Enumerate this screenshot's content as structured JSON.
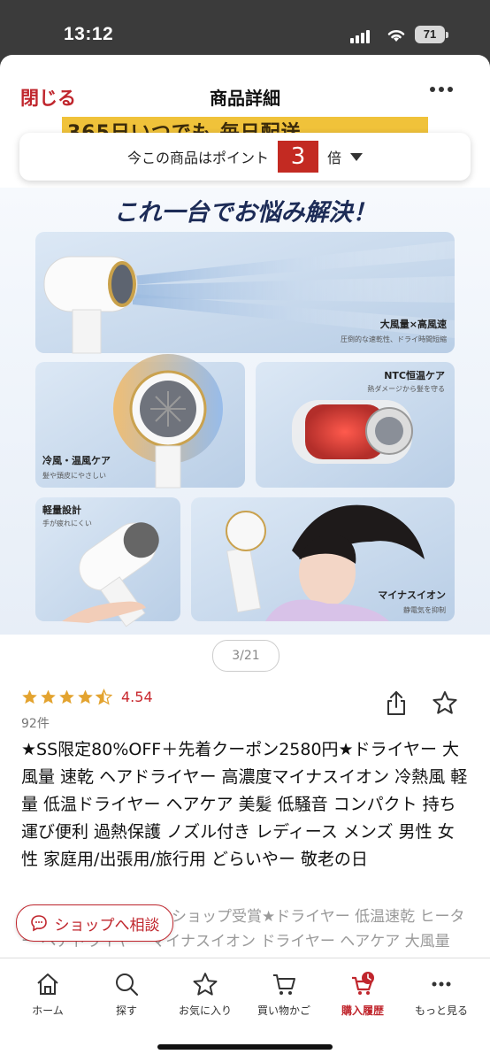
{
  "status": {
    "time": "13:12",
    "battery": "71"
  },
  "header": {
    "close_label": "閉じる",
    "title": "商品詳細"
  },
  "points": {
    "prefix": "今この商品はポイント",
    "multiplier": "3",
    "suffix": "倍"
  },
  "banner": {
    "headline": "これ一台でお悩み解決！",
    "strip_text": "365日いつでも 毎日配送"
  },
  "features": [
    {
      "title": "大風量×高風速",
      "desc": "圧倒的な速乾性、ドライ時間短縮"
    },
    {
      "title": "冷風・温風ケア",
      "desc": "髪や頭皮にやさしい"
    },
    {
      "title": "NTC恒温ケア",
      "desc": "熱ダメージから髪を守る"
    },
    {
      "title": "軽量設計",
      "desc": "手が疲れにくい"
    },
    {
      "title": "マイナスイオン",
      "desc": "静電気を抑制"
    }
  ],
  "pager": "3/21",
  "rating": {
    "value": "4.54",
    "count": "92件",
    "stars": 4.5
  },
  "product_title": "★SS限定80%OFF＋先着クーポン2580円★ドライヤー 大風量 速乾 ヘアドライヤー 高濃度マイナスイオン 冷熱風 軽量 低温ドライヤー ヘアケア 美髪 低騒音 コンパクト 持ち運び便利 過熱保護 ノズル付き レディース メンズ 男性 女性 家庭用/出張用/旅行用 どらいやー 敬老の日",
  "subtitle": "ショップ受賞★ドライヤー 低温速乾 ヒーター ヘアドライヤー マイナスイオン ドライヤー ヘアケア 大風量 速乾 時短 低温 髪に優しい PSE認",
  "shop_button": "ショップへ相談",
  "tabs": [
    {
      "label": "ホーム",
      "icon": "home-icon"
    },
    {
      "label": "探す",
      "icon": "search-icon"
    },
    {
      "label": "お気に入り",
      "icon": "star-icon"
    },
    {
      "label": "買い物かご",
      "icon": "cart-icon"
    },
    {
      "label": "購入履歴",
      "icon": "history-icon",
      "active": true
    },
    {
      "label": "もっと見る",
      "icon": "more-icon"
    }
  ],
  "colors": {
    "accent": "#c0262d",
    "star": "#e3a32f"
  }
}
